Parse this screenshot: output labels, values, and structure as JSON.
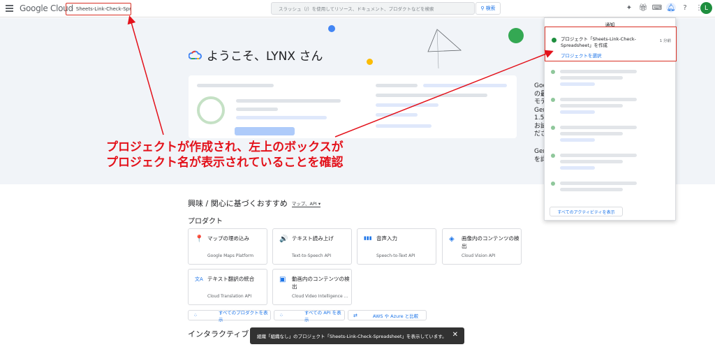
{
  "topbar": {
    "logo_text": "Google Cloud",
    "project_name": "Sheets-Link-Check-Spreadsheet",
    "search_placeholder": "スラッシュ（/）を使用してリソース、ドキュメント、プロダクトなどを検索",
    "search_button": "検索",
    "avatar_initial": "L"
  },
  "hero": {
    "welcome": "ようこそ、LYNX さん",
    "side_text": [
      "Goo",
      "の最",
      "モデ",
      "Gen",
      "1.5",
      "お試",
      "ださ",
      "Gen",
      "を詳"
    ]
  },
  "annotation": {
    "line1": "プロジェクトが作成され、左上のボックスが",
    "line2": "プロジェクト名が表示されていることを確認"
  },
  "recommend": {
    "title": "興味 / 関心に基づくおすすめ",
    "chip": "マップ、API ▾",
    "products_title": "プロダクト",
    "products": [
      {
        "icon": "map-pin-icon",
        "glyph": "📍",
        "title": "マップの埋め込み",
        "sub": "Google Maps Platform"
      },
      {
        "icon": "tts-icon",
        "glyph": "🔊",
        "title": "テキスト読み上げ",
        "sub": "Text-to-Speech API"
      },
      {
        "icon": "mic-icon",
        "glyph": "▮▮▮",
        "title": "音声入力",
        "sub": "Speech-to-Text API"
      },
      {
        "icon": "vision-icon",
        "glyph": "◈",
        "title": "画像内のコンテンツの検出",
        "sub": "Cloud Vision API"
      },
      {
        "icon": "translate-icon",
        "glyph": "文A",
        "title": "テキスト翻訳の統合",
        "sub": "Cloud Translation API"
      },
      {
        "icon": "video-icon",
        "glyph": "▣",
        "title": "動画内のコンテンツの検出",
        "sub": "Cloud Video Intelligence ..."
      }
    ],
    "buttons": [
      "すべてのプロダクトを表示",
      "すべての API を表示",
      "AWS や Azure と比較"
    ],
    "interactive_title": "インタラクティブ チ"
  },
  "notifications": {
    "header": "通知",
    "item_text": "プロジェクト「Sheets-Link-Check-Spreadsheet」を作成",
    "item_time": "1 分前",
    "item_link": "プロジェクトを選択",
    "view_all": "すべてのアクティビティを表示"
  },
  "toast": {
    "text": "組織「組織なし」のプロジェクト「Sheets-Link-Check-Spreadsheet」を表示しています。",
    "close": "✕"
  }
}
